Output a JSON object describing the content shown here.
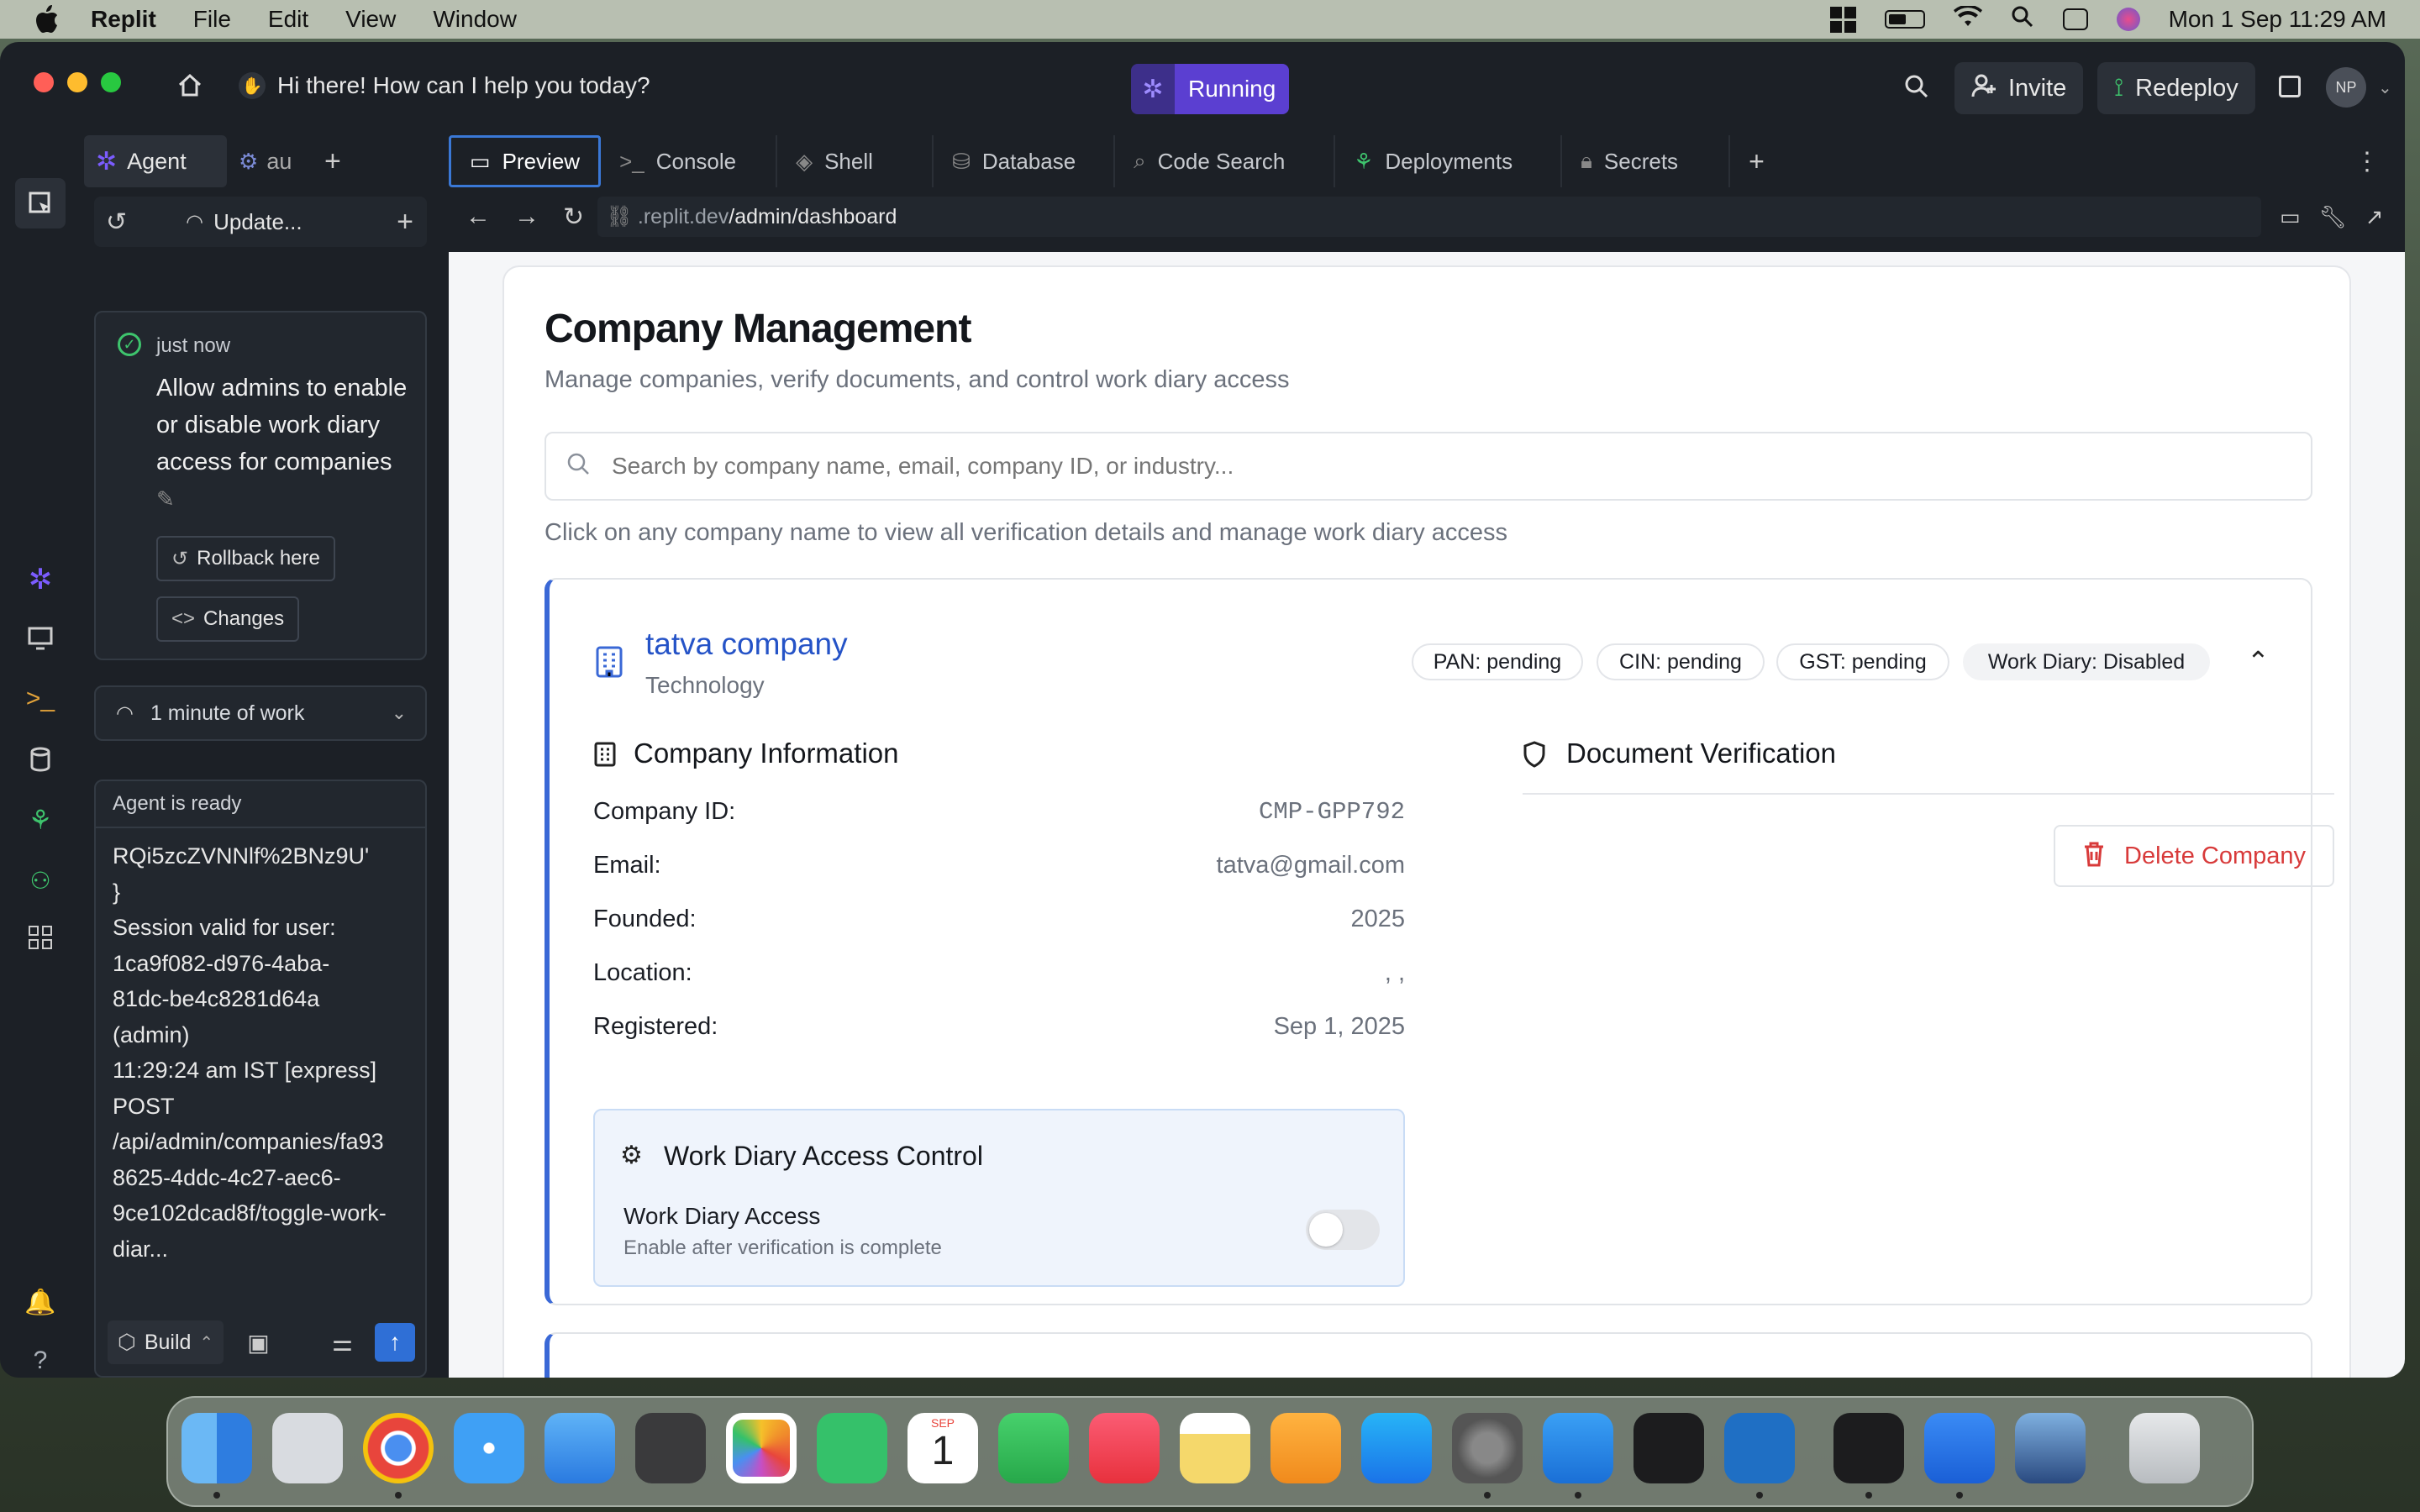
{
  "menubar": {
    "app": "Replit",
    "items": [
      "File",
      "Edit",
      "View",
      "Window"
    ],
    "datetime": "Mon 1 Sep  11:29 AM"
  },
  "titlebar": {
    "prompt": "Hi there! How can I help you today?",
    "status": "Running",
    "invite": "Invite",
    "redeploy": "Redeploy",
    "avatar": "NP"
  },
  "agent": {
    "tab_agent": "Agent",
    "tab_other": "au",
    "update_label": "Update...",
    "checkpoint": {
      "time": "just now",
      "message": "Allow admins to enable or disable work diary access for companies",
      "rollback": "Rollback here",
      "changes": "Changes"
    },
    "work_summary": "1 minute of work",
    "status": "Agent is ready",
    "log_lines": [
      "RQi5zcZVNNlf%2BNz9U'",
      "}",
      "Session valid for user:",
      "1ca9f082-d976-4aba-",
      "81dc-be4c8281d64a",
      "(admin)",
      "11:29:24 am IST [express]",
      "POST",
      "/api/admin/companies/fa93",
      "8625-4ddc-4c27-aec6-",
      "9ce102dcad8f/toggle-work-",
      "diar..."
    ],
    "build_label": "Build"
  },
  "preview_tabs": [
    "Preview",
    "Console",
    "Shell",
    "Database",
    "Code Search",
    "Deployments",
    "Secrets"
  ],
  "url": {
    "prefix": ".replit.dev",
    "path": "/admin/dashboard"
  },
  "page": {
    "title": "Company Management",
    "subtitle": "Manage companies, verify documents, and control work diary access",
    "search_placeholder": "Search by company name, email, company ID, or industry...",
    "hint": "Click on any company name to view all verification details and manage work diary access",
    "company": {
      "name": "tatva company",
      "industry": "Technology",
      "badges": [
        "PAN: pending",
        "CIN: pending",
        "GST: pending",
        "Work Diary: Disabled"
      ],
      "info_heading": "Company Information",
      "doc_heading": "Document Verification",
      "fields": [
        {
          "label": "Company ID:",
          "value": "CMP-GPP792"
        },
        {
          "label": "Email:",
          "value": "tatva@gmail.com"
        },
        {
          "label": "Founded:",
          "value": "2025"
        },
        {
          "label": "Location:",
          "value": ", ,"
        },
        {
          "label": "Registered:",
          "value": "Sep 1, 2025"
        }
      ],
      "delete_label": "Delete Company",
      "access_control": {
        "heading": "Work Diary Access Control",
        "label": "Work Diary Access",
        "sub": "Enable after verification is complete",
        "enabled": false
      }
    }
  },
  "colors": {
    "accent": "#3a78d6",
    "company_link": "#2553c7",
    "delete": "#d83a3a",
    "running_bg": "#5b3fd1"
  },
  "dock_calendar": {
    "month": "SEP",
    "day": "1"
  }
}
